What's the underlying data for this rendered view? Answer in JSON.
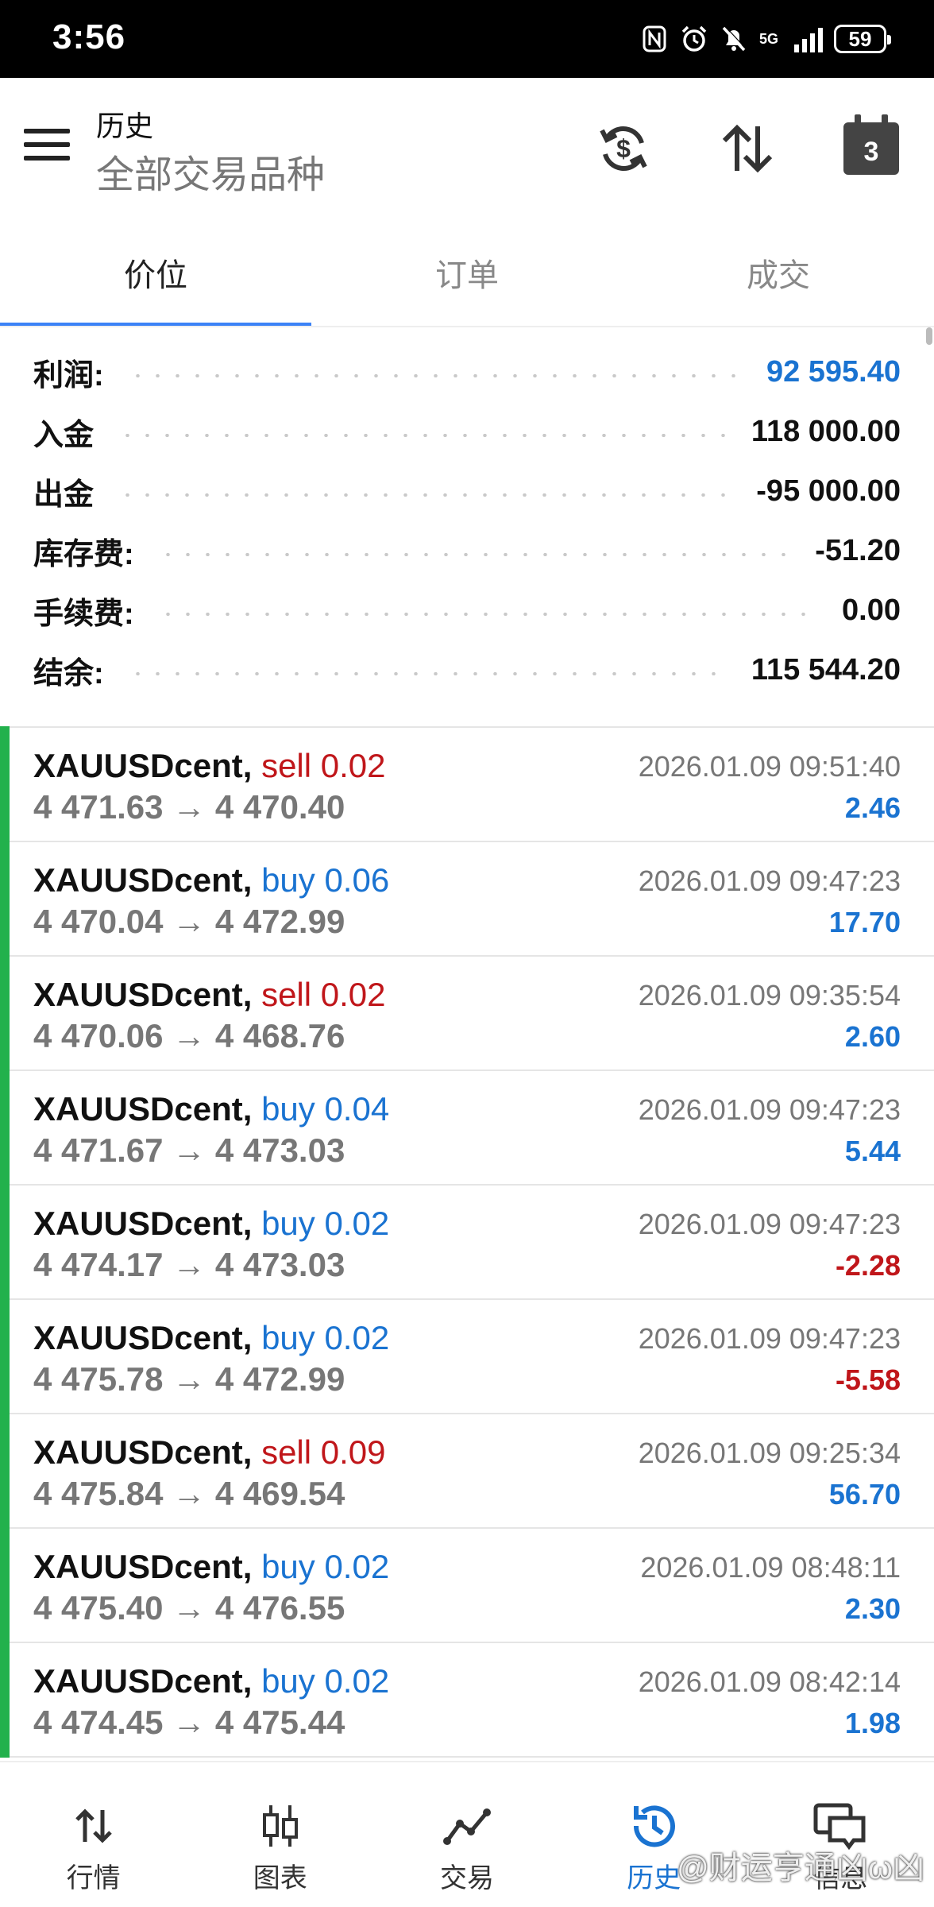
{
  "status_bar": {
    "time": "3:56",
    "network": "5G",
    "battery": "59"
  },
  "header": {
    "title": "历史",
    "subtitle": "全部交易品种",
    "calendar_day": "3"
  },
  "tabs": [
    {
      "label": "价位",
      "active": true
    },
    {
      "label": "订单",
      "active": false
    },
    {
      "label": "成交",
      "active": false
    }
  ],
  "summary": [
    {
      "label": "利润:",
      "value": "92 595.40",
      "highlight": true
    },
    {
      "label": "入金",
      "value": "118 000.00"
    },
    {
      "label": "出金",
      "value": "-95 000.00"
    },
    {
      "label": "库存费:",
      "value": "-51.20"
    },
    {
      "label": "手续费:",
      "value": "0.00"
    },
    {
      "label": "结余:",
      "value": "115 544.20"
    }
  ],
  "trades": [
    {
      "symbol": "XAUUSDcent,",
      "side": "sell 0.02",
      "type": "sell",
      "prices": "4 471.63 → 4 470.40",
      "time": "2026.01.09 09:51:40",
      "profit": "2.46",
      "sign": "pos"
    },
    {
      "symbol": "XAUUSDcent,",
      "side": "buy 0.06",
      "type": "buy",
      "prices": "4 470.04 → 4 472.99",
      "time": "2026.01.09 09:47:23",
      "profit": "17.70",
      "sign": "pos"
    },
    {
      "symbol": "XAUUSDcent,",
      "side": "sell 0.02",
      "type": "sell",
      "prices": "4 470.06 → 4 468.76",
      "time": "2026.01.09 09:35:54",
      "profit": "2.60",
      "sign": "pos"
    },
    {
      "symbol": "XAUUSDcent,",
      "side": "buy 0.04",
      "type": "buy",
      "prices": "4 471.67 → 4 473.03",
      "time": "2026.01.09 09:47:23",
      "profit": "5.44",
      "sign": "pos"
    },
    {
      "symbol": "XAUUSDcent,",
      "side": "buy 0.02",
      "type": "buy",
      "prices": "4 474.17 → 4 473.03",
      "time": "2026.01.09 09:47:23",
      "profit": "-2.28",
      "sign": "neg"
    },
    {
      "symbol": "XAUUSDcent,",
      "side": "buy 0.02",
      "type": "buy",
      "prices": "4 475.78 → 4 472.99",
      "time": "2026.01.09 09:47:23",
      "profit": "-5.58",
      "sign": "neg"
    },
    {
      "symbol": "XAUUSDcent,",
      "side": "sell 0.09",
      "type": "sell",
      "prices": "4 475.84 → 4 469.54",
      "time": "2026.01.09 09:25:34",
      "profit": "56.70",
      "sign": "pos"
    },
    {
      "symbol": "XAUUSDcent,",
      "side": "buy 0.02",
      "type": "buy",
      "prices": "4 475.40 → 4 476.55",
      "time": "2026.01.09 08:48:11",
      "profit": "2.30",
      "sign": "pos"
    },
    {
      "symbol": "XAUUSDcent,",
      "side": "buy 0.02",
      "type": "buy",
      "prices": "4 474.45 → 4 475.44",
      "time": "2026.01.09 08:42:14",
      "profit": "1.98",
      "sign": "pos"
    }
  ],
  "bottom_nav": [
    {
      "label": "行情",
      "icon": "quotes-icon"
    },
    {
      "label": "图表",
      "icon": "chart-icon"
    },
    {
      "label": "交易",
      "icon": "trade-icon"
    },
    {
      "label": "历史",
      "icon": "history-icon",
      "active": true
    },
    {
      "label": "信息",
      "icon": "messages-icon"
    }
  ],
  "watermark": "@财运亨通凶ω凶",
  "colors": {
    "accent_blue": "#1a73d1",
    "loss_red": "#c0161a",
    "trade_bar_green": "#22b14c"
  }
}
